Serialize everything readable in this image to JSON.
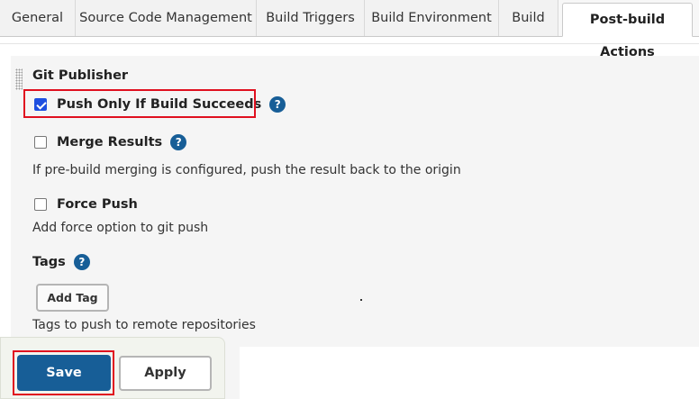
{
  "tabs": [
    {
      "label": "General"
    },
    {
      "label": "Source Code Management"
    },
    {
      "label": "Build Triggers"
    },
    {
      "label": "Build Environment"
    },
    {
      "label": "Build"
    },
    {
      "label": "Post-build Actions",
      "active": true
    }
  ],
  "section": {
    "title": "Git Publisher",
    "push_only": {
      "label": "Push Only If Build Succeeds",
      "checked": true,
      "help": "?"
    },
    "merge_results": {
      "label": "Merge Results",
      "checked": false,
      "help": "?",
      "description": "If pre-build merging is configured, push the result back to the origin"
    },
    "force_push": {
      "label": "Force Push",
      "checked": false,
      "description": "Add force option to git push"
    },
    "tags": {
      "label": "Tags",
      "help": "?",
      "add_button": "Add Tag",
      "description": "Tags to push to remote repositories"
    }
  },
  "footer": {
    "save_label": "Save",
    "apply_label": "Apply"
  },
  "colors": {
    "accent": "#175e97",
    "highlight": "#e0101f",
    "checkbox": "#1e4fe0"
  }
}
